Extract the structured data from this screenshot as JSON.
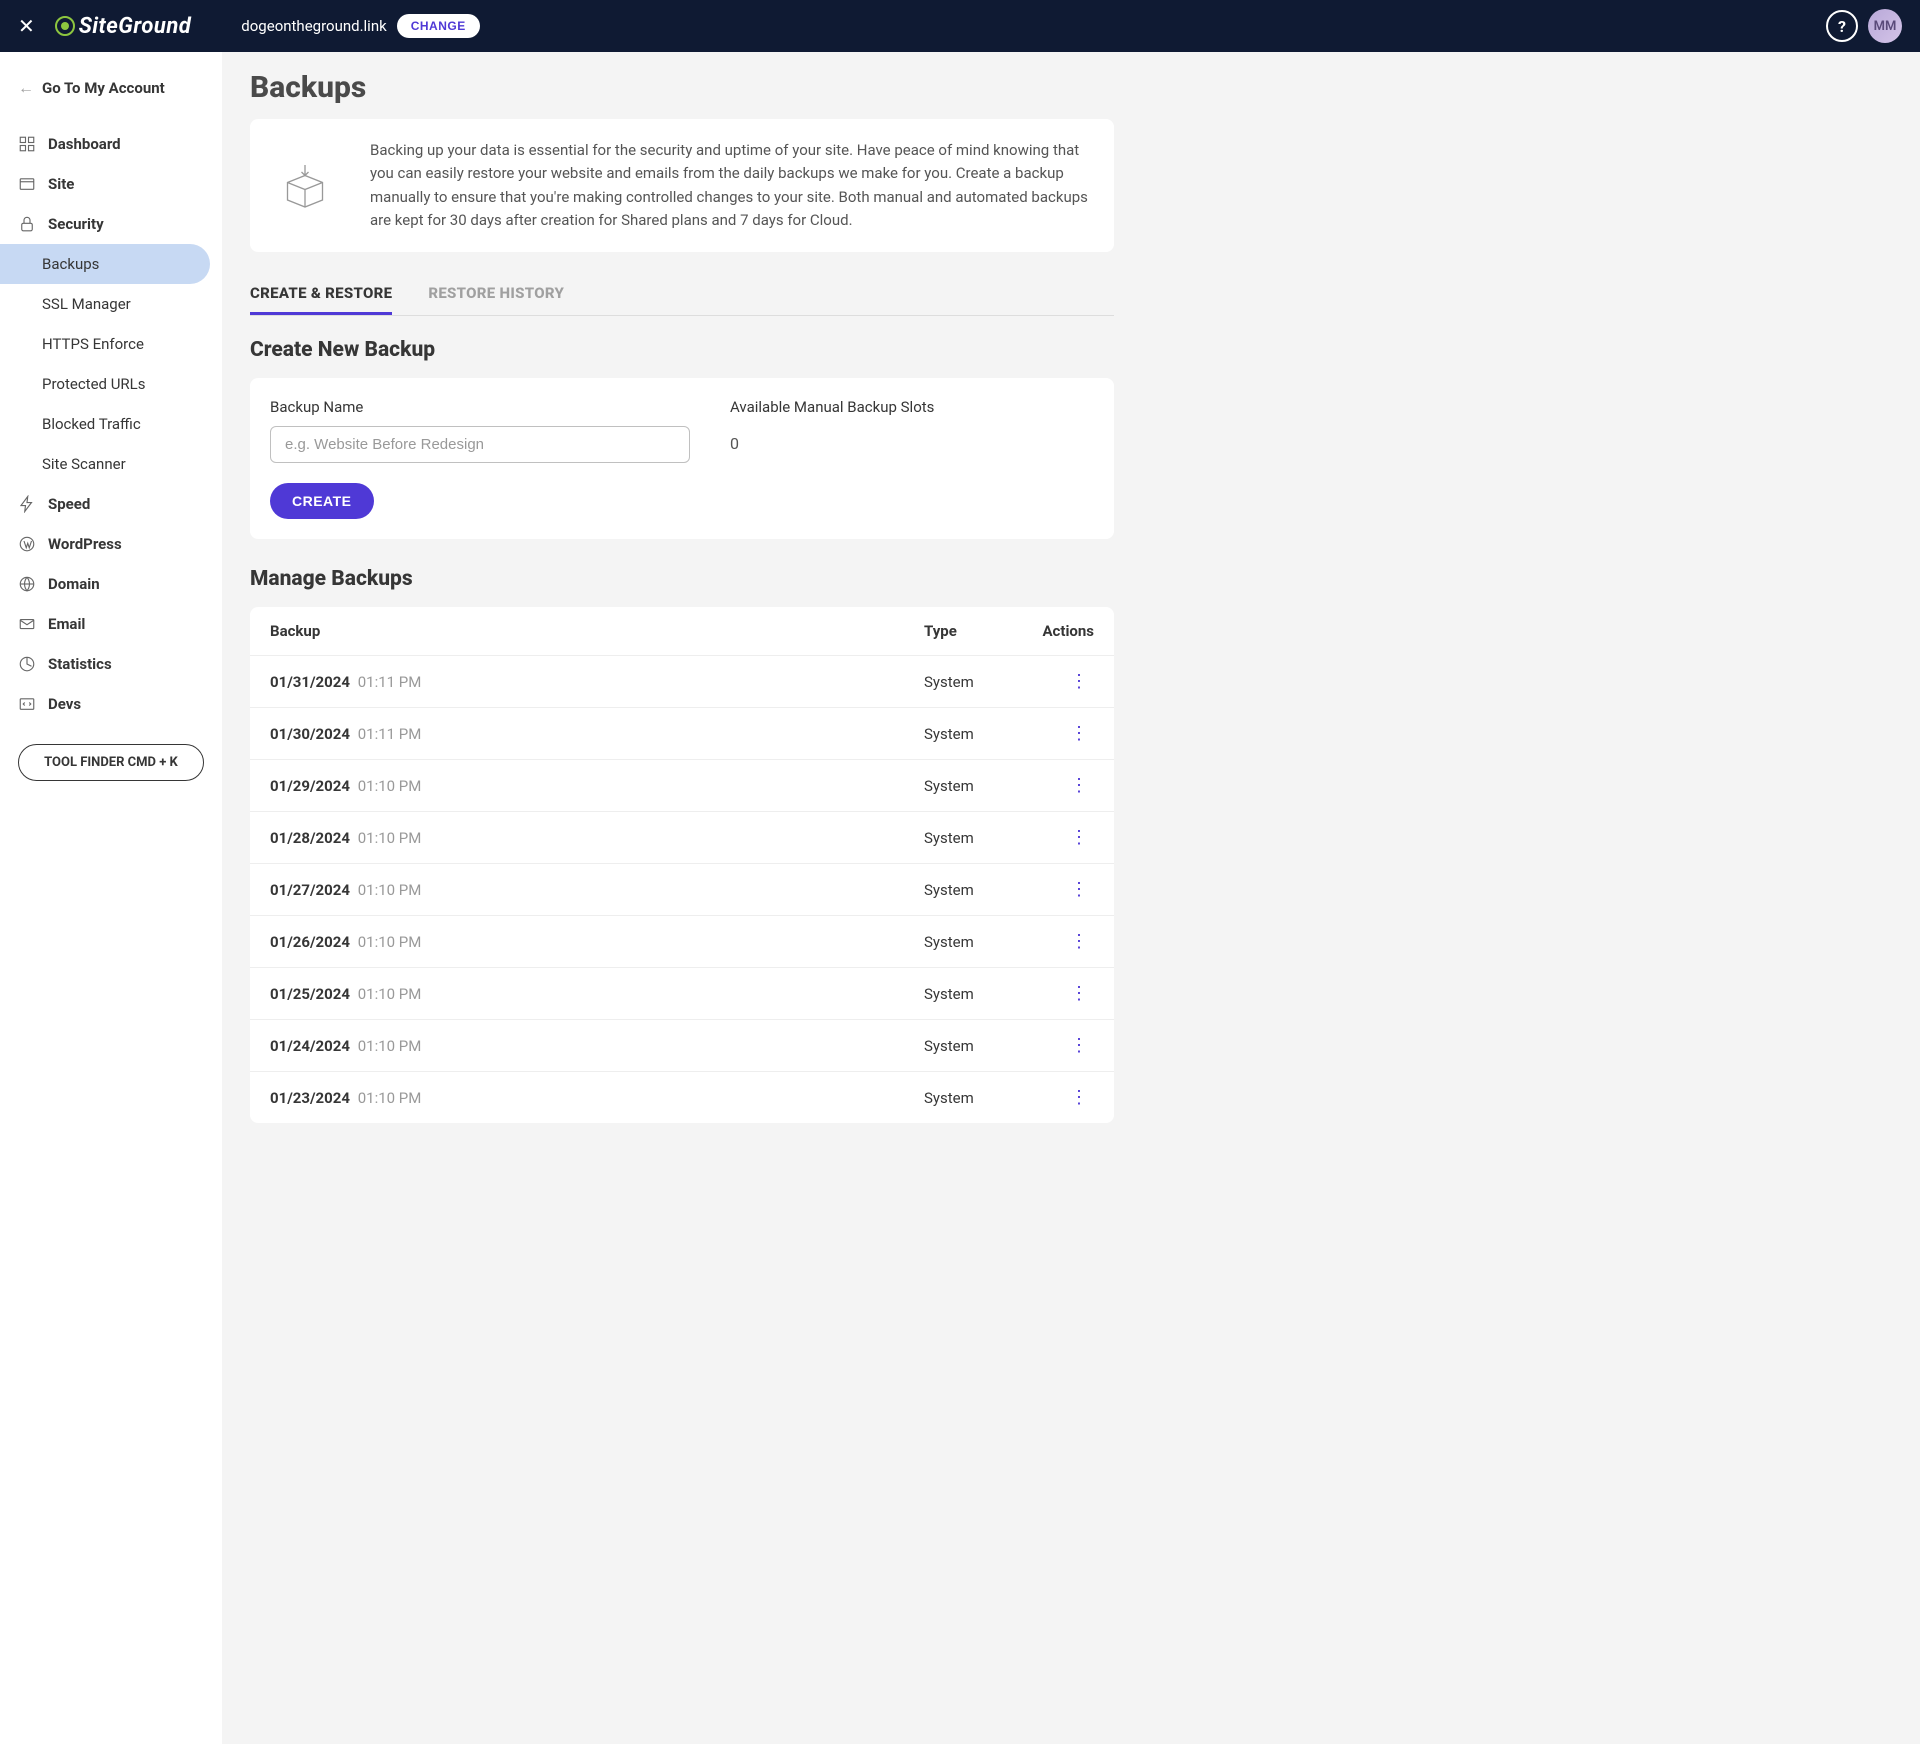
{
  "header": {
    "domain": "dogeontheground.link",
    "change_label": "CHANGE",
    "avatar_initials": "MM",
    "logo_text": "SiteGround"
  },
  "sidebar": {
    "back_label": "Go To My Account",
    "items": [
      {
        "label": "Dashboard"
      },
      {
        "label": "Site"
      },
      {
        "label": "Security"
      },
      {
        "label": "Speed"
      },
      {
        "label": "WordPress"
      },
      {
        "label": "Domain"
      },
      {
        "label": "Email"
      },
      {
        "label": "Statistics"
      },
      {
        "label": "Devs"
      }
    ],
    "security_subitems": [
      {
        "label": "Backups"
      },
      {
        "label": "SSL Manager"
      },
      {
        "label": "HTTPS Enforce"
      },
      {
        "label": "Protected URLs"
      },
      {
        "label": "Blocked Traffic"
      },
      {
        "label": "Site Scanner"
      }
    ],
    "tool_finder": "TOOL FINDER CMD + K"
  },
  "page": {
    "title": "Backups",
    "description": "Backing up your data is essential for the security and uptime of your site. Have peace of mind knowing that you can easily restore your website and emails from the daily backups we make for you. Create a backup manually to ensure that you're making controlled changes to your site. Both manual and automated backups are kept for 30 days after creation for Shared plans and 7 days for Cloud."
  },
  "tabs": [
    {
      "label": "CREATE & RESTORE"
    },
    {
      "label": "RESTORE HISTORY"
    }
  ],
  "create": {
    "section_title": "Create New Backup",
    "name_label": "Backup Name",
    "name_placeholder": "e.g. Website Before Redesign",
    "slots_label": "Available Manual Backup Slots",
    "slots_value": "0",
    "button": "CREATE"
  },
  "manage": {
    "section_title": "Manage Backups",
    "columns": {
      "backup": "Backup",
      "type": "Type",
      "actions": "Actions"
    },
    "rows": [
      {
        "date": "01/31/2024",
        "time": "01:11 PM",
        "type": "System"
      },
      {
        "date": "01/30/2024",
        "time": "01:11 PM",
        "type": "System"
      },
      {
        "date": "01/29/2024",
        "time": "01:10 PM",
        "type": "System"
      },
      {
        "date": "01/28/2024",
        "time": "01:10 PM",
        "type": "System"
      },
      {
        "date": "01/27/2024",
        "time": "01:10 PM",
        "type": "System"
      },
      {
        "date": "01/26/2024",
        "time": "01:10 PM",
        "type": "System"
      },
      {
        "date": "01/25/2024",
        "time": "01:10 PM",
        "type": "System"
      },
      {
        "date": "01/24/2024",
        "time": "01:10 PM",
        "type": "System"
      },
      {
        "date": "01/23/2024",
        "time": "01:10 PM",
        "type": "System"
      }
    ]
  }
}
